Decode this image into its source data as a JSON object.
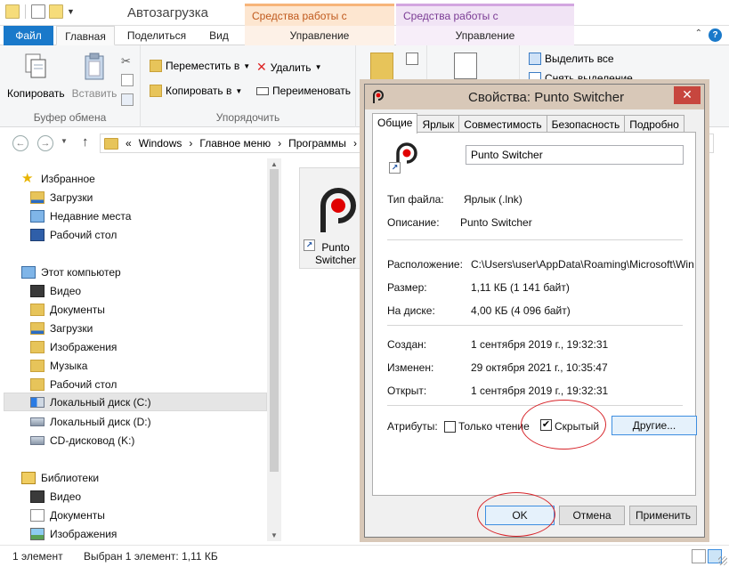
{
  "explorer": {
    "title": "Автозагрузка",
    "context_tab_shortcuts": "Средства работы с ярлыками",
    "context_tab_apps": "Средства работы с приложениями",
    "tabs": {
      "file": "Файл",
      "home": "Главная",
      "share": "Поделиться",
      "view": "Вид",
      "manage_a": "Управление",
      "manage_b": "Управление"
    },
    "ribbon": {
      "copy": "Копировать",
      "paste": "Вставить",
      "clipboard_group": "Буфер обмена",
      "move_to": "Переместить в",
      "copy_to": "Копировать в",
      "delete": "Удалить",
      "rename": "Переименовать",
      "organize_group": "Упорядочить",
      "select_all": "Выделить все",
      "deselect": "Снять выделение"
    },
    "address": {
      "prefix": "«",
      "path": [
        "Windows",
        "Главное меню",
        "Программы"
      ]
    },
    "nav": {
      "favorites": "Избранное",
      "favorites_items": [
        "Загрузки",
        "Недавние места",
        "Рабочий стол"
      ],
      "this_pc": "Этот компьютер",
      "pc_items": [
        "Видео",
        "Документы",
        "Загрузки",
        "Изображения",
        "Музыка",
        "Рабочий стол"
      ],
      "drives": [
        "Локальный диск (C:)",
        "Локальный диск (D:)",
        "CD-дисковод (K:)"
      ],
      "libraries": "Библиотеки",
      "library_items": [
        "Видео",
        "Документы",
        "Изображения"
      ]
    },
    "file_tile": {
      "label": "Punto Switcher"
    },
    "status": {
      "count": "1 элемент",
      "selected": "Выбран 1 элемент: 1,11 КБ"
    }
  },
  "dialog": {
    "title": "Свойства: Punto Switcher",
    "close": "✕",
    "tabs": [
      "Общие",
      "Ярлык",
      "Совместимость",
      "Безопасность",
      "Подробно"
    ],
    "name_value": "Punto Switcher",
    "type_label": "Тип файла:",
    "type_value": "Ярлык (.lnk)",
    "desc_label": "Описание:",
    "desc_value": "Punto Switcher",
    "location_label": "Расположение:",
    "location_value": "C:\\Users\\user\\AppData\\Roaming\\Microsoft\\Window",
    "size_label": "Размер:",
    "size_value": "1,11 КБ (1 141 байт)",
    "disk_label": "На диске:",
    "disk_value": "4,00 КБ (4 096 байт)",
    "created_label": "Создан:",
    "created_value": "1 сентября 2019 г., 19:32:31",
    "modified_label": "Изменен:",
    "modified_value": "29 октября 2021 г., 10:35:47",
    "opened_label": "Открыт:",
    "opened_value": "1 сентября 2019 г., 19:32:31",
    "attributes_label": "Атрибуты:",
    "readonly_label": "Только чтение",
    "hidden_label": "Скрытый",
    "hidden_checked": "✔",
    "other_button": "Другие...",
    "ok_button": "OK",
    "cancel_button": "Отмена",
    "apply_button": "Применить"
  },
  "colors": {
    "file_tab": "#1979ca",
    "dialog_title": "#d8c8b8",
    "annotation": "#d7242a"
  }
}
